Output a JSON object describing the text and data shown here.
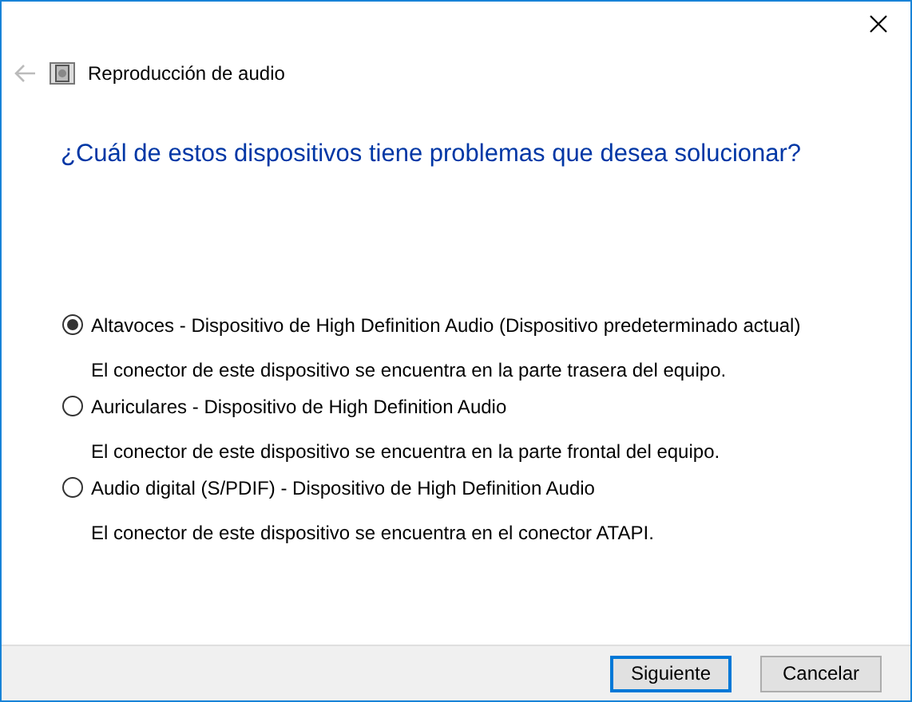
{
  "window": {
    "title": "Reproducción de audio"
  },
  "heading": "¿Cuál de estos dispositivos tiene problemas que desea solucionar?",
  "devices": [
    {
      "label": "Altavoces - Dispositivo de High Definition Audio (Dispositivo predeterminado actual)",
      "description": "El conector de este dispositivo se encuentra en la parte trasera del equipo.",
      "selected": true
    },
    {
      "label": "Auriculares - Dispositivo de High Definition Audio",
      "description": "El conector de este dispositivo se encuentra en la parte frontal del equipo.",
      "selected": false
    },
    {
      "label": "Audio digital (S/PDIF) - Dispositivo de High Definition Audio",
      "description": "El conector de este dispositivo se encuentra en el conector ATAPI.",
      "selected": false
    }
  ],
  "buttons": [
    {
      "label": "Siguiente",
      "default": true
    },
    {
      "label": "Cancelar",
      "default": false
    }
  ]
}
